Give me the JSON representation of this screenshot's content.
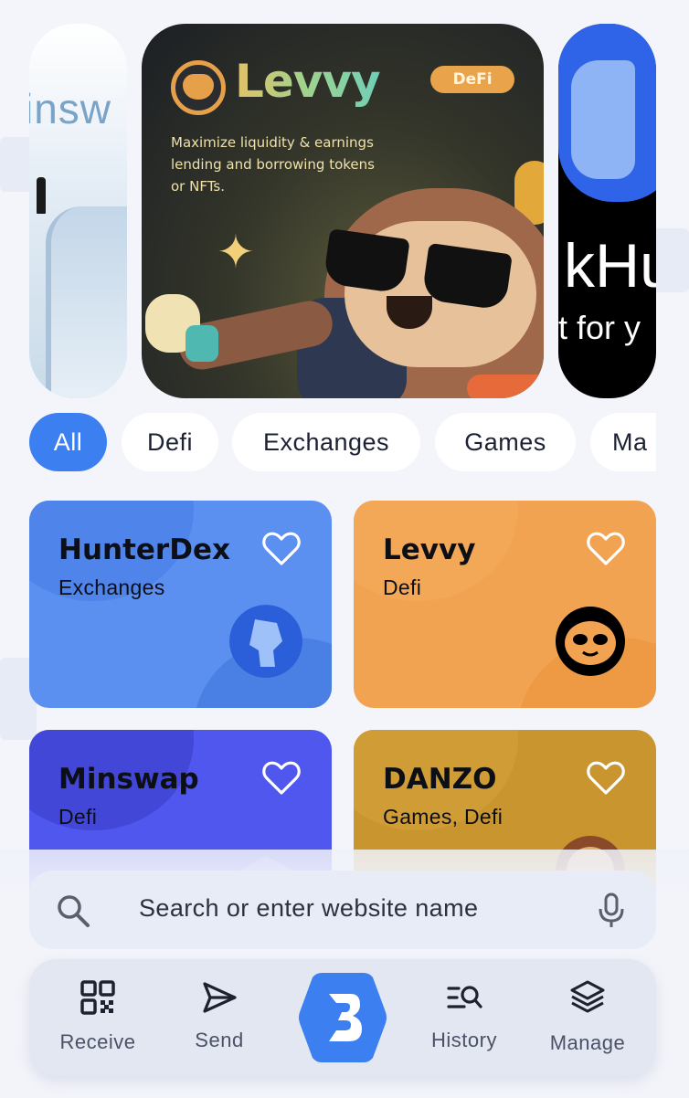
{
  "carousel": {
    "left_card": {
      "word": "insw"
    },
    "main_card": {
      "brand": "Levvy",
      "badge": "DeFi",
      "description": "Maximize liquidity & earnings lending and borrowing tokens or NFTs."
    },
    "right_card": {
      "line1": "kHu",
      "line2": "t for y"
    }
  },
  "categories": [
    {
      "label": "All",
      "active": true
    },
    {
      "label": "Defi",
      "active": false
    },
    {
      "label": "Exchanges",
      "active": false
    },
    {
      "label": "Games",
      "active": false
    },
    {
      "label": "Ma",
      "active": false
    }
  ],
  "dapps": [
    {
      "name": "HunterDex",
      "category": "Exchanges",
      "color": "#5b8ff0",
      "logo": "hunterdex-logo-icon"
    },
    {
      "name": "Levvy",
      "category": "Defi",
      "color": "#f2a352",
      "logo": "levvy-sloth-logo-icon"
    },
    {
      "name": "Minswap",
      "category": "Defi",
      "color": "#5057ee",
      "logo": "minswap-logo-icon"
    },
    {
      "name": "DANZO",
      "category": "Games, Defi",
      "color": "#c9952f",
      "logo": "danzo-logo-icon"
    }
  ],
  "search": {
    "placeholder": "Search or enter website name"
  },
  "nav": {
    "items": [
      {
        "label": "Receive",
        "icon": "qr-code-icon"
      },
      {
        "label": "Send",
        "icon": "send-icon"
      },
      {
        "label": "",
        "icon": "brand-logo-icon"
      },
      {
        "label": "History",
        "icon": "history-search-icon"
      },
      {
        "label": "Manage",
        "icon": "layers-icon"
      }
    ]
  },
  "colors": {
    "accent": "#3b7ff0",
    "background": "#f3f5fb"
  }
}
